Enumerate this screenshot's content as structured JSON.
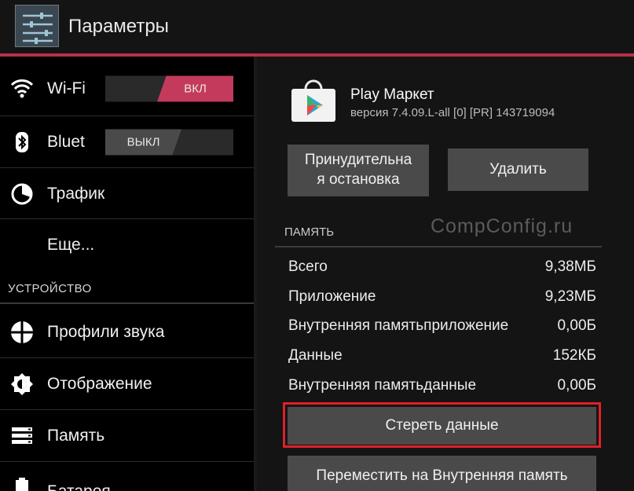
{
  "header": {
    "title": "Параметры"
  },
  "sidebar": {
    "wifi": {
      "label": "Wi-Fi",
      "switch": "ВКЛ",
      "state": "on"
    },
    "bluetooth": {
      "label": "Bluet",
      "switch": "ВЫКЛ",
      "state": "off"
    },
    "traffic": {
      "label": "Трафик"
    },
    "more": {
      "label": "Еще..."
    },
    "device_section": "УСТРОЙСТВО",
    "sound": {
      "label": "Профили звука"
    },
    "display": {
      "label": "Отображение"
    },
    "memory": {
      "label": "Память"
    },
    "battery": {
      "label": "Батарея"
    }
  },
  "app": {
    "name": "Play Маркет",
    "version": "версия 7.4.09.L-all [0] [PR] 143719094",
    "force_stop": "Принудительная остановка",
    "force_stop_l1": "Принудительна",
    "force_stop_l2": "я остановка",
    "uninstall": "Удалить"
  },
  "watermark": "CompConfig.ru",
  "memory": {
    "header": "ПАМЯТЬ",
    "rows": [
      {
        "label": "Всего",
        "value": "9,38МБ"
      },
      {
        "label": "Приложение",
        "value": "9,23МБ"
      },
      {
        "label": "Внутренняя памятьприложение",
        "value": "0,00Б"
      },
      {
        "label": "Данные",
        "value": "152КБ"
      },
      {
        "label": "Внутренняя памятьданные",
        "value": "0,00Б"
      }
    ],
    "clear_data": "Стереть данные",
    "move": "Переместить на Внутренняя память"
  },
  "colors": {
    "accent": "#b83048",
    "switch_on": "#c33a5c",
    "highlight": "#e0202a"
  },
  "icons": [
    "settings-icon",
    "wifi-icon",
    "bluetooth-icon",
    "traffic-icon",
    "sound-icon",
    "display-icon",
    "memory-icon",
    "battery-icon",
    "play-store-icon"
  ]
}
